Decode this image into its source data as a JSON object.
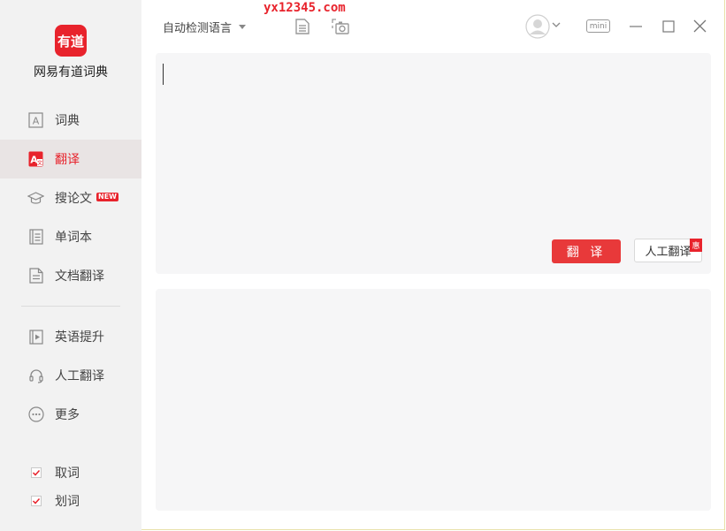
{
  "watermark": "yx12345.com",
  "app": {
    "logo_text": "有道",
    "name": "网易有道词典"
  },
  "nav": {
    "items": [
      {
        "label": "词典",
        "icon": "dictionary-icon"
      },
      {
        "label": "翻译",
        "icon": "translate-icon",
        "active": true
      },
      {
        "label": "搜论文",
        "icon": "graduation-cap-icon",
        "badge": "NEW"
      },
      {
        "label": "单词本",
        "icon": "wordbook-icon"
      },
      {
        "label": "文档翻译",
        "icon": "document-icon"
      },
      {
        "label": "英语提升",
        "icon": "video-play-icon"
      },
      {
        "label": "人工翻译",
        "icon": "headset-icon"
      },
      {
        "label": "更多",
        "icon": "more-icon"
      }
    ]
  },
  "options": [
    {
      "label": "取词",
      "checked": true
    },
    {
      "label": "划词",
      "checked": true
    }
  ],
  "toolbar": {
    "language": "自动检测语言",
    "mini_label": "mini"
  },
  "translate": {
    "button_label": "翻 译",
    "human_label": "人工翻译",
    "human_badge": "惠",
    "input_value": ""
  },
  "colors": {
    "accent": "#e8232c",
    "panel_bg": "#f6f6f7",
    "sidebar_bg": "#f2f2f2"
  }
}
